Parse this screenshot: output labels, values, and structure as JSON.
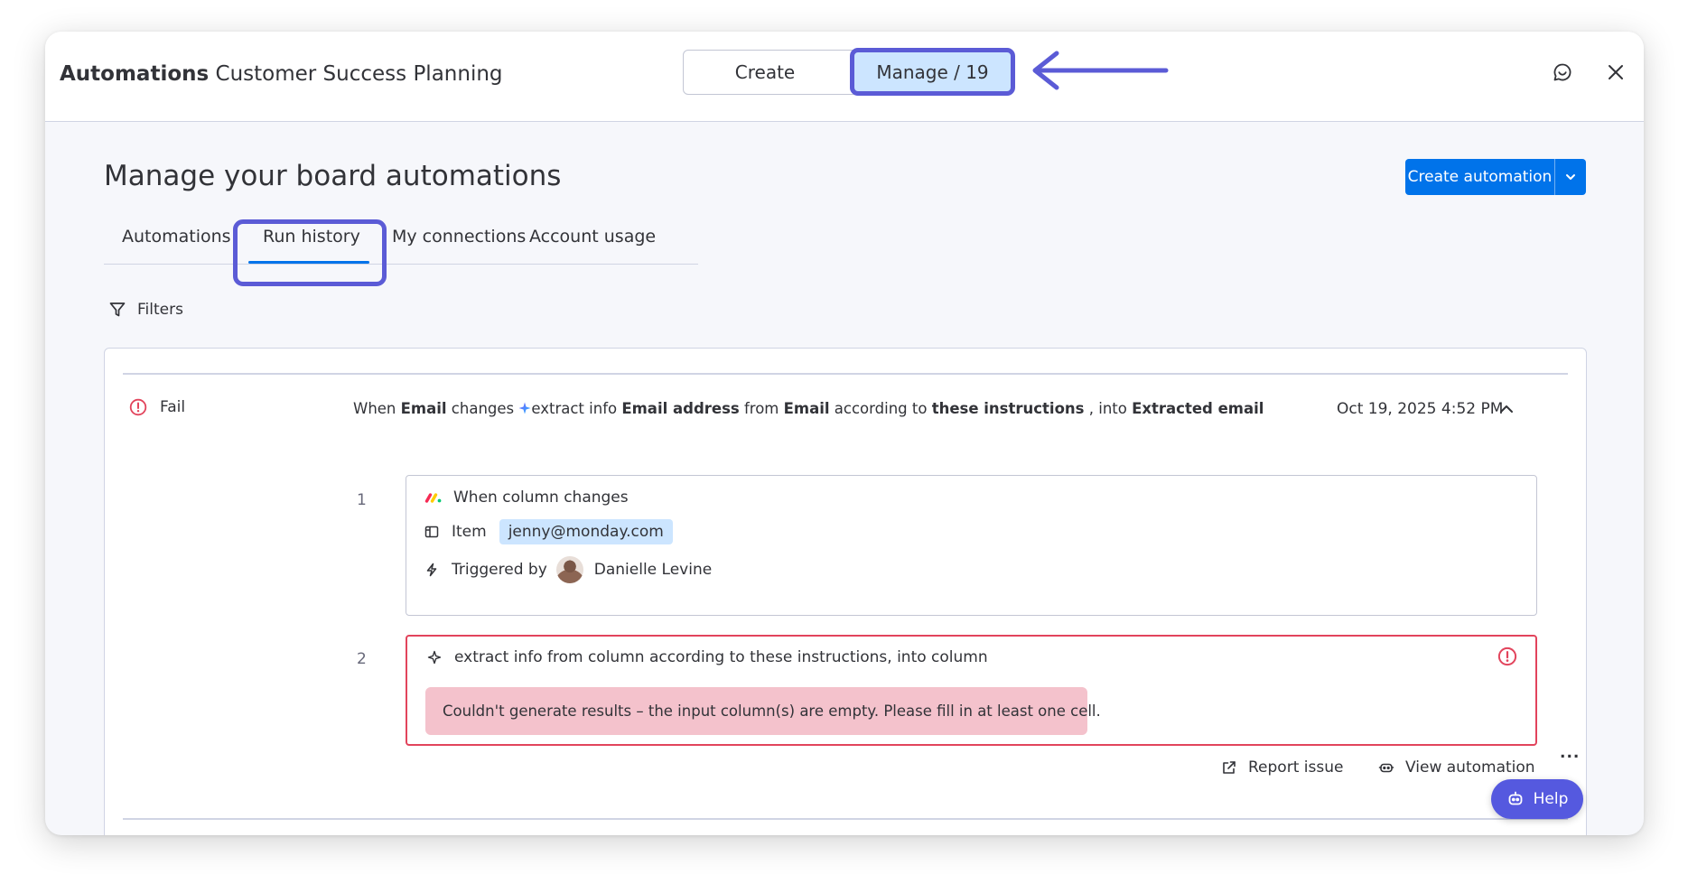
{
  "header": {
    "app_name": "Automations",
    "board_name": "Customer Success Planning",
    "segments": {
      "create": "Create",
      "manage": "Manage / 19"
    }
  },
  "page": {
    "title": "Manage your board automations",
    "create_button": "Create automation"
  },
  "tabs": [
    {
      "label": "Automations"
    },
    {
      "label": "Run history"
    },
    {
      "label": "My connections"
    },
    {
      "label": "Account usage"
    }
  ],
  "active_tab": "Run history",
  "filters_label": "Filters",
  "run": {
    "status": "Fail",
    "desc": {
      "p1": "When ",
      "b1": "Email",
      "p2": " changes ",
      "p3": "extract info ",
      "b2": "Email address",
      "p4": " from ",
      "b3": "Email",
      "p5": " according to ",
      "b4": "these instructions",
      "p6": " , into ",
      "b5": "Extracted email"
    },
    "date": "Oct 19, 2025 4:52 PM",
    "steps": [
      {
        "number": "1",
        "title": "When column changes",
        "item_label": "Item",
        "item_value": "jenny@monday.com",
        "triggered_label": "Triggered by",
        "triggered_user": "Danielle Levine"
      },
      {
        "number": "2",
        "title": "extract info from column according to these instructions, into column",
        "error": "Couldn't generate results – the input column(s) are empty. Please fill in at least one cell."
      }
    ],
    "actions": {
      "report": "Report issue",
      "view": "View automation",
      "more": "..."
    }
  },
  "help_label": "Help",
  "colors": {
    "accent": "#0073ea",
    "annotation": "#5b5bd6",
    "error": "#e2445c",
    "error_bg": "#f4c2cc",
    "chip_bg": "#cce5ff"
  }
}
